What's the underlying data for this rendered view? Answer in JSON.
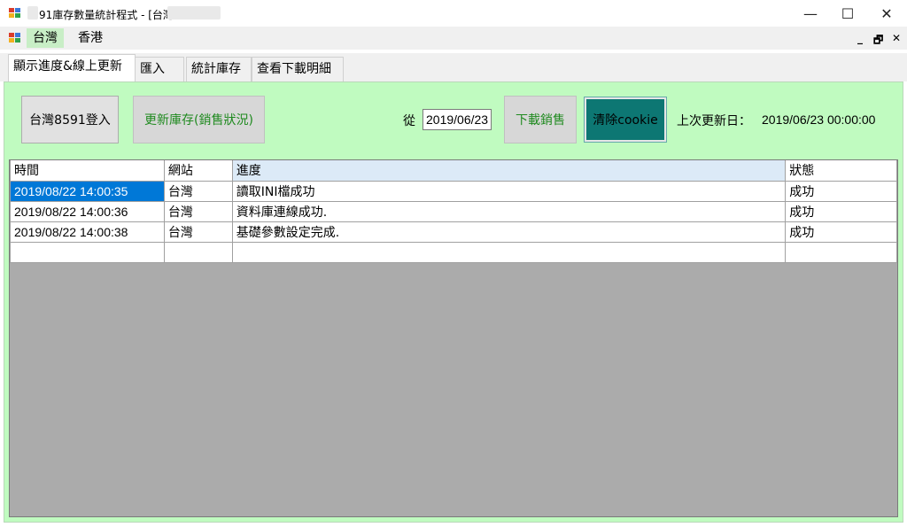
{
  "window": {
    "title": "91庫存數量統計程式 - [台灣",
    "controls": {
      "minimize": "—",
      "maximize": "☐",
      "close": "✕"
    }
  },
  "menu": {
    "items": [
      "台灣",
      "香港"
    ],
    "mdi_controls": {
      "minimize": "_",
      "restore": "🗗",
      "close": "✕"
    }
  },
  "tabs": [
    "顯示進度&線上更新",
    "匯入",
    "統計庫存",
    "查看下載明細"
  ],
  "toolbar": {
    "login_label": "台灣8591登入",
    "update_stock_label": "更新庫存(銷售狀況)",
    "from_label": "從",
    "from_date": "2019/06/23",
    "download_sales_label": "下載銷售",
    "clear_cookie_label": "清除cookie",
    "last_update_label": "上次更新日：",
    "last_update_value": "2019/06/23 00:00:00"
  },
  "grid": {
    "columns": [
      "時間",
      "網站",
      "進度",
      "狀態"
    ],
    "rows": [
      [
        "2019/08/22 14:00:35",
        "台灣",
        "讀取INI檔成功",
        "成功"
      ],
      [
        "2019/08/22 14:00:36",
        "台灣",
        "資料庫連線成功.",
        "成功"
      ],
      [
        "2019/08/22 14:00:38",
        "台灣",
        "基礎參數設定完成.",
        "成功"
      ]
    ]
  },
  "colors": {
    "panel_background": "#c0fbc0",
    "menu_active": "#c8eec6",
    "selection": "#0078d7",
    "teal_button": "#0d7773",
    "green_text": "#1f8a1f"
  }
}
